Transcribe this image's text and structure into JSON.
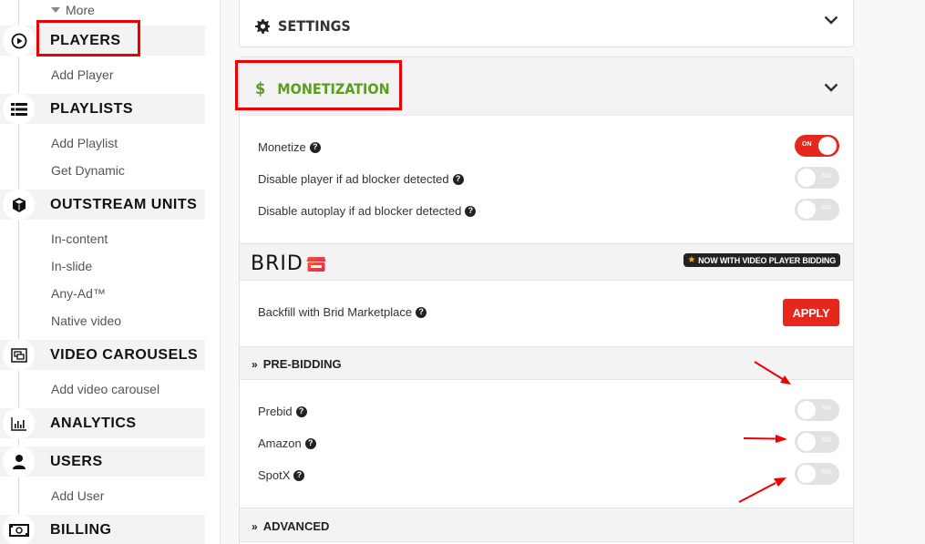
{
  "sidebar": {
    "more_label": "More",
    "sections": [
      {
        "label": "PLAYERS",
        "icon": "play-circle-icon",
        "items": [
          "Add Player"
        ]
      },
      {
        "label": "PLAYLISTS",
        "icon": "list-icon",
        "items": [
          "Add Playlist",
          "Get Dynamic"
        ]
      },
      {
        "label": "OUTSTREAM UNITS",
        "icon": "cube-icon",
        "items": [
          "In-content",
          "In-slide",
          "Any-Ad™",
          "Native video"
        ]
      },
      {
        "label": "VIDEO CAROUSELS",
        "icon": "carousel-icon",
        "items": [
          "Add video carousel"
        ]
      },
      {
        "label": "ANALYTICS",
        "icon": "bar-chart-icon",
        "items": []
      },
      {
        "label": "USERS",
        "icon": "user-icon",
        "items": [
          "Add User"
        ]
      },
      {
        "label": "BILLING",
        "icon": "money-icon",
        "items": []
      }
    ]
  },
  "settings": {
    "title": "SETTINGS",
    "icon": "gear-icon"
  },
  "monetization": {
    "title": "MONETIZATION",
    "icon": "dollar-icon",
    "accent_color": "#5a9e1f",
    "rows": [
      {
        "label": "Monetize",
        "state": "ON",
        "on": true
      },
      {
        "label": "Disable player if ad blocker detected",
        "state": "NO",
        "on": false
      },
      {
        "label": "Disable autoplay if ad blocker detected",
        "state": "NO",
        "on": false
      }
    ],
    "brid": {
      "logo_text": "BRID",
      "badge": "NOW WITH VIDEO PLAYER BIDDING"
    },
    "backfill": {
      "label": "Backfill with Brid Marketplace",
      "button": "APPLY"
    },
    "prebidding": {
      "title": "PRE-BIDDING",
      "rows": [
        {
          "label": "Prebid",
          "state": "NO",
          "on": false
        },
        {
          "label": "Amazon",
          "state": "NO",
          "on": false
        },
        {
          "label": "SpotX",
          "state": "NO",
          "on": false
        }
      ]
    },
    "advanced": {
      "title": "ADVANCED"
    }
  },
  "colors": {
    "toggle_on": "#e5271d",
    "toggle_off": "#e2e2e2",
    "annotation_red": "#e00000"
  }
}
